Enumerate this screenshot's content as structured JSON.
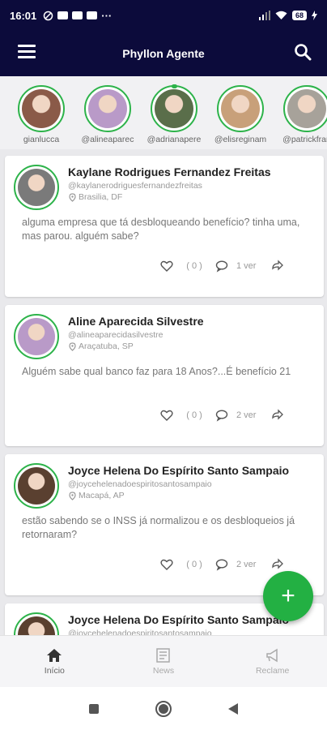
{
  "status_bar": {
    "time": "16:01",
    "dots": "···",
    "battery": "68"
  },
  "app_bar": {
    "title": "Phyllon Agente"
  },
  "stories": [
    {
      "handle": "gianlucca",
      "color": "#8a5a48"
    },
    {
      "handle": "@alineaparec",
      "color": "#b99ac8"
    },
    {
      "handle": "@adrianapere",
      "color": "#5a6e4a"
    },
    {
      "handle": "@elisreginam",
      "color": "#c8a07a"
    },
    {
      "handle": "@patrickfran",
      "color": "#a7a29a"
    }
  ],
  "posts": [
    {
      "author": "Kaylane Rodrigues Fernandez Freitas",
      "handle": "@kaylanerodriguesfernandezfreitas",
      "location": "Brasilia, DF",
      "body": "alguma empresa que tá desbloqueando benefício? tinha uma, mas parou. alguém sabe?",
      "likes": "( 0 )",
      "ago": "1 ver",
      "avatar_color": "#7a7a7a"
    },
    {
      "author": "Aline Aparecida Silvestre",
      "handle": "@alineaparecidasilvestre",
      "location": "Araçatuba, SP",
      "body": "Alguém sabe qual banco faz para 18 Anos?...É benefício 21",
      "likes": "( 0 )",
      "ago": "2 ver",
      "avatar_color": "#b99ac8"
    },
    {
      "author": "Joyce Helena Do Espírito Santo Sampaio",
      "handle": "@joycehelenadoespiritosantosampaio",
      "location": "Macapá, AP",
      "body": "estão sabendo se o INSS já normalizou e os desbloqueios já retornaram?",
      "likes": "( 0 )",
      "ago": "2 ver",
      "avatar_color": "#5a4030"
    },
    {
      "author": "Joyce Helena Do Espírito Santo Sampaio",
      "handle": "@joycehelenadoespiritosantosampaio",
      "location": "",
      "body": "",
      "likes": "",
      "ago": "",
      "avatar_color": "#5a4030"
    }
  ],
  "fab": {
    "label": "+"
  },
  "tabs": [
    {
      "label": "Início"
    },
    {
      "label": "News"
    },
    {
      "label": "Reclame"
    }
  ],
  "colors": {
    "brand_dark": "#0c0b3b",
    "accent_green": "#23b043"
  }
}
